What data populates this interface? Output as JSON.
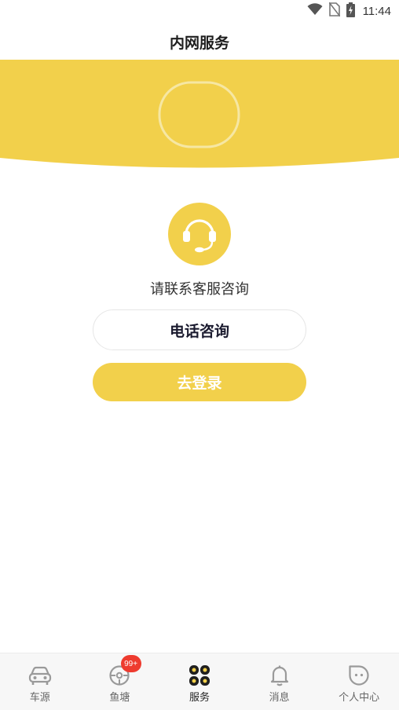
{
  "status_bar": {
    "time": "11:44",
    "icons": [
      "wifi-icon",
      "no-sim-icon",
      "battery-charging-icon"
    ]
  },
  "header": {
    "title": "内网服务"
  },
  "support": {
    "icon": "headset-icon",
    "prompt": "请联系客服咨询"
  },
  "buttons": {
    "phone_label": "电话咨询",
    "login_label": "去登录"
  },
  "tab_bar": {
    "items": [
      {
        "label": "车源",
        "icon": "car-icon",
        "active": false
      },
      {
        "label": "鱼塘",
        "icon": "target-icon",
        "active": false,
        "badge": "99+"
      },
      {
        "label": "服务",
        "icon": "grid-icon",
        "active": true
      },
      {
        "label": "消息",
        "icon": "bell-icon",
        "active": false
      },
      {
        "label": "个人中心",
        "icon": "face-icon",
        "active": false
      }
    ]
  },
  "colors": {
    "accent": "#f2d04b",
    "badge": "#ee3b2f",
    "text_primary": "#1e1e1e",
    "text_secondary": "#666666"
  }
}
